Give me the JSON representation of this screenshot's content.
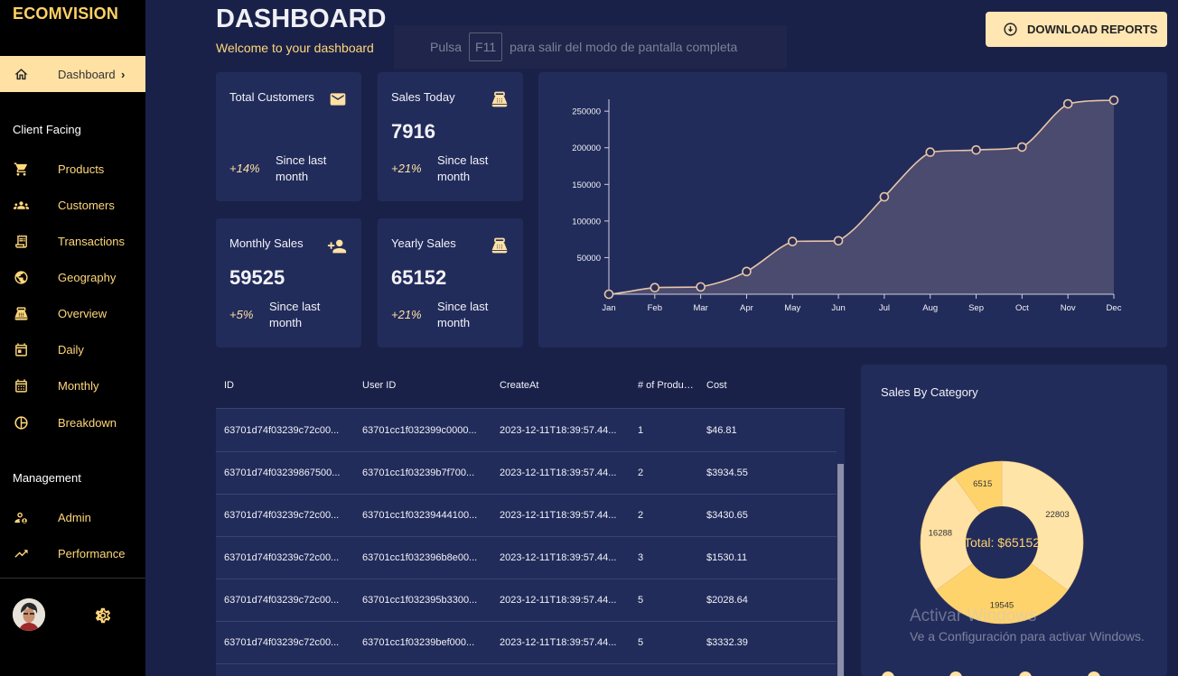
{
  "brand": "ECOMVISION",
  "sidebar": {
    "dashboard": {
      "label": "Dashboard",
      "chevron": "›"
    },
    "sections": {
      "client": "Client Facing",
      "management": "Management"
    },
    "items": [
      {
        "label": "Products",
        "icon": "cart-icon"
      },
      {
        "label": "Customers",
        "icon": "groups-icon"
      },
      {
        "label": "Transactions",
        "icon": "receipt-icon"
      },
      {
        "label": "Geography",
        "icon": "globe-icon"
      },
      {
        "label": "Overview",
        "icon": "point-of-sale-icon"
      },
      {
        "label": "Daily",
        "icon": "calendar-today-icon"
      },
      {
        "label": "Monthly",
        "icon": "calendar-month-icon"
      },
      {
        "label": "Breakdown",
        "icon": "pie-chart-icon"
      },
      {
        "label": "Admin",
        "icon": "admin-icon"
      },
      {
        "label": "Performance",
        "icon": "trending-up-icon"
      }
    ]
  },
  "header": {
    "title": "DASHBOARD",
    "subtitle": "Welcome to your dashboard",
    "download_label": "DOWNLOAD REPORTS"
  },
  "fullscreen_toast": {
    "prefix": "Pulsa",
    "key": "F11",
    "suffix": "para salir del modo de pantalla completa"
  },
  "stats": [
    {
      "title": "Total Customers",
      "value": "",
      "pct": "+14%",
      "since": "Since last month",
      "icon": "email-icon"
    },
    {
      "title": "Sales Today",
      "value": "7916",
      "pct": "+21%",
      "since": "Since last month",
      "icon": "point-of-sale-icon"
    },
    {
      "title": "Monthly Sales",
      "value": "59525",
      "pct": "+5%",
      "since": "Since last month",
      "icon": "person-add-icon"
    },
    {
      "title": "Yearly Sales",
      "value": "65152",
      "pct": "+21%",
      "since": "Since last month",
      "icon": "point-of-sale-icon"
    }
  ],
  "chart_data": [
    {
      "type": "area",
      "x": [
        "Jan",
        "Feb",
        "Mar",
        "Apr",
        "May",
        "Jun",
        "Jul",
        "Aug",
        "Sep",
        "Oct",
        "Nov",
        "Dec"
      ],
      "series": [
        {
          "values": [
            0,
            9000,
            10000,
            31000,
            72000,
            73000,
            133000,
            194000,
            197000,
            201000,
            260000,
            265000
          ]
        }
      ],
      "yticks": [
        50000,
        100000,
        150000,
        200000,
        250000
      ],
      "ylim": [
        0,
        265000
      ],
      "grid": false,
      "fill_color": "#4f4f70",
      "line_color": "#e8c4a8"
    },
    {
      "type": "pie",
      "title": "Sales By Category",
      "labels": [
        "",
        "",
        "",
        ""
      ],
      "values": [
        22803,
        19545,
        16288,
        6515
      ],
      "colors": [
        "#ffe4a8",
        "#ffd36b",
        "#ffe1a3",
        "#ffd36b"
      ],
      "center_text": "Total: $65152"
    }
  ],
  "table": {
    "columns": [
      "ID",
      "User ID",
      "CreateAt",
      "# of Products",
      "Cost"
    ],
    "rows": [
      [
        "63701d74f03239c72c00...",
        "63701cc1f032399c0000...",
        "2023-12-11T18:39:57.44...",
        "1",
        "$46.81"
      ],
      [
        "63701d74f03239867500...",
        "63701cc1f03239b7f700...",
        "2023-12-11T18:39:57.44...",
        "2",
        "$3934.55"
      ],
      [
        "63701d74f03239c72c00...",
        "63701cc1f03239444100...",
        "2023-12-11T18:39:57.44...",
        "2",
        "$3430.65"
      ],
      [
        "63701d74f03239c72c00...",
        "63701cc1f032396b8e00...",
        "2023-12-11T18:39:57.44...",
        "3",
        "$1530.11"
      ],
      [
        "63701d74f03239c72c00...",
        "63701cc1f032395b3300...",
        "2023-12-11T18:39:57.44...",
        "5",
        "$2028.64"
      ],
      [
        "63701d74f03239c72c00...",
        "63701cc1f03239bef000...",
        "2023-12-11T18:39:57.44...",
        "5",
        "$3332.39"
      ]
    ]
  },
  "watermark": {
    "line1": "Activar Windows",
    "line2": "Ve a Configuración para activar Windows."
  }
}
